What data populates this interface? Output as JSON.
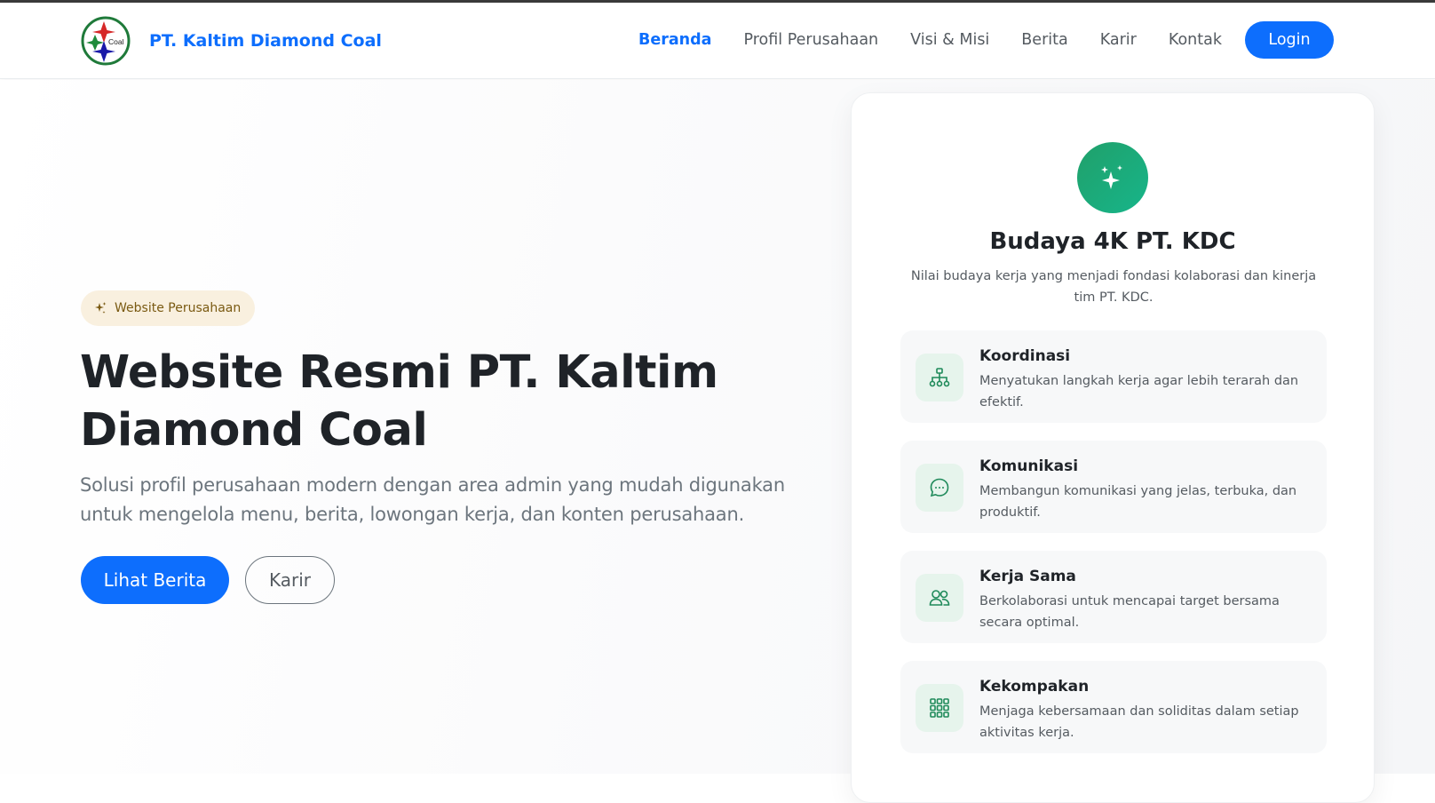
{
  "header": {
    "brand_name": "PT. Kaltim Diamond Coal",
    "logo_text": "Coal",
    "nav": [
      "Beranda",
      "Profil Perusahaan",
      "Visi & Misi",
      "Berita",
      "Karir",
      "Kontak"
    ],
    "login_label": "Login"
  },
  "hero": {
    "badge": "Website Perusahaan",
    "title": "Website Resmi PT. Kaltim Diamond Coal",
    "subtitle": "Solusi profil perusahaan modern dengan area admin yang mudah digunakan untuk mengelola menu, berita, lowongan kerja, dan konten perusahaan.",
    "primary_button": "Lihat Berita",
    "secondary_button": "Karir"
  },
  "culture": {
    "title": "Budaya 4K PT. KDC",
    "description": "Nilai budaya kerja yang menjadi fondasi kolaborasi dan kinerja tim PT. KDC.",
    "values": [
      {
        "name": "Koordinasi",
        "text": "Menyatukan langkah kerja agar lebih terarah dan efektif.",
        "icon": "hierarchy-icon"
      },
      {
        "name": "Komunikasi",
        "text": "Membangun komunikasi yang jelas, terbuka, dan produktif.",
        "icon": "chat-icon"
      },
      {
        "name": "Kerja Sama",
        "text": "Berkolaborasi untuk mencapai target bersama secara optimal.",
        "icon": "people-icon"
      },
      {
        "name": "Kekompakan",
        "text": "Menjaga kebersamaan dan soliditas dalam setiap aktivitas kerja.",
        "icon": "grid-icon"
      }
    ]
  },
  "colors": {
    "primary": "#0d6efd",
    "accent_green": "#1fa870",
    "badge_bg": "#f9f0df"
  }
}
